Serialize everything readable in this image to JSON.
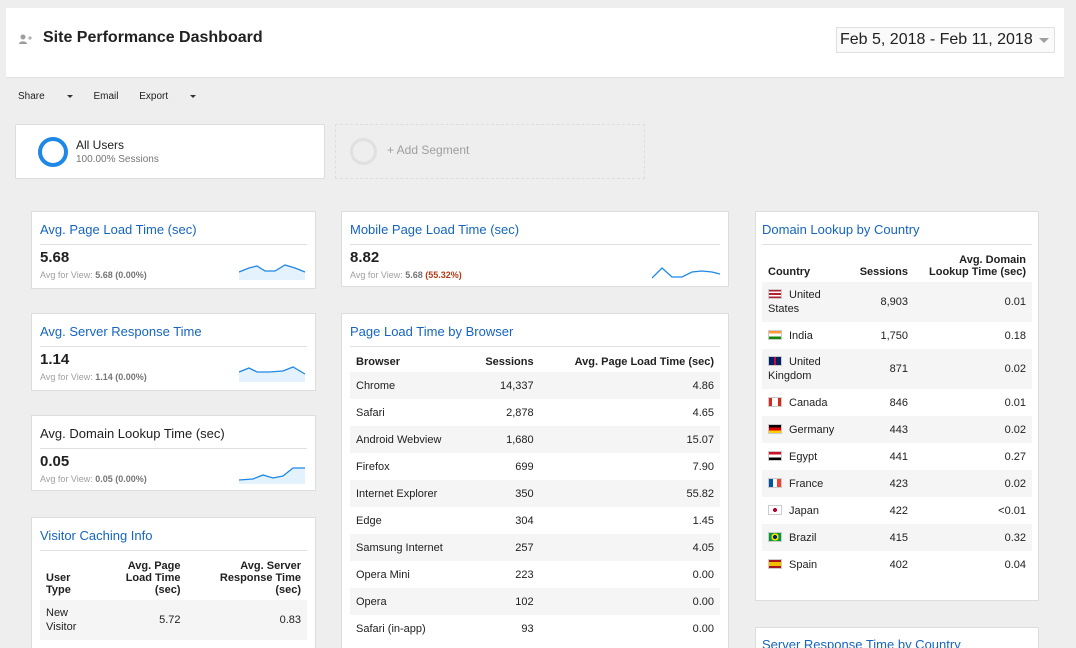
{
  "header": {
    "title": "Site Performance Dashboard",
    "date_range": "Feb 5, 2018 - Feb 11, 2018"
  },
  "toolbar": {
    "share": "Share",
    "email": "Email",
    "export": "Export"
  },
  "segments": {
    "all_users": {
      "name": "All Users",
      "sub": "100.00% Sessions"
    },
    "add_segment": "+ Add Segment"
  },
  "colors": {
    "accent": "#1e88e5",
    "link": "#1565c0",
    "warn": "#b23c17"
  },
  "avg_page_load": {
    "title": "Avg. Page Load Time (sec)",
    "value": "5.68",
    "avg_label": "Avg for View:",
    "avg_value": "5.68",
    "avg_change": "(0.00%)"
  },
  "avg_server": {
    "title": "Avg. Server Response Time",
    "value": "1.14",
    "avg_label": "Avg for View:",
    "avg_value": "1.14",
    "avg_change": "(0.00%)"
  },
  "avg_domain": {
    "title": "Avg. Domain Lookup Time (sec)",
    "value": "0.05",
    "avg_label": "Avg for View:",
    "avg_value": "0.05",
    "avg_change": "(0.00%)"
  },
  "mobile_load": {
    "title": "Mobile Page Load Time (sec)",
    "value": "8.82",
    "avg_label": "Avg for View:",
    "avg_value": "5.68",
    "avg_change": "(55.32%)"
  },
  "visitor_caching": {
    "title": "Visitor Caching Info",
    "headers": [
      "User Type",
      "Avg. Page Load Time (sec)",
      "Avg. Server Response Time (sec)"
    ],
    "rows": [
      {
        "type": "New Visitor",
        "load": "5.72",
        "server": "0.83"
      }
    ]
  },
  "browser_table": {
    "title": "Page Load Time by Browser",
    "headers": [
      "Browser",
      "Sessions",
      "Avg. Page Load Time (sec)"
    ],
    "rows": [
      {
        "browser": "Chrome",
        "sessions": "14,337",
        "load": "4.86"
      },
      {
        "browser": "Safari",
        "sessions": "2,878",
        "load": "4.65"
      },
      {
        "browser": "Android Webview",
        "sessions": "1,680",
        "load": "15.07"
      },
      {
        "browser": "Firefox",
        "sessions": "699",
        "load": "7.90"
      },
      {
        "browser": "Internet Explorer",
        "sessions": "350",
        "load": "55.82"
      },
      {
        "browser": "Edge",
        "sessions": "304",
        "load": "1.45"
      },
      {
        "browser": "Samsung Internet",
        "sessions": "257",
        "load": "4.05"
      },
      {
        "browser": "Opera Mini",
        "sessions": "223",
        "load": "0.00"
      },
      {
        "browser": "Opera",
        "sessions": "102",
        "load": "0.00"
      },
      {
        "browser": "Safari (in-app)",
        "sessions": "93",
        "load": "0.00"
      }
    ]
  },
  "domain_table": {
    "title": "Domain Lookup by Country",
    "headers": [
      "Country",
      "Sessions",
      "Avg. Domain Lookup Time (sec)"
    ],
    "rows": [
      {
        "country": "United States",
        "sessions": "8,903",
        "time": "0.01",
        "flag": "flag-us"
      },
      {
        "country": "India",
        "sessions": "1,750",
        "time": "0.18",
        "flag": "flag-in"
      },
      {
        "country": "United Kingdom",
        "sessions": "871",
        "time": "0.02",
        "flag": "flag-gb"
      },
      {
        "country": "Canada",
        "sessions": "846",
        "time": "0.01",
        "flag": "flag-ca"
      },
      {
        "country": "Germany",
        "sessions": "443",
        "time": "0.02",
        "flag": "flag-de"
      },
      {
        "country": "Egypt",
        "sessions": "441",
        "time": "0.27",
        "flag": "flag-eg"
      },
      {
        "country": "France",
        "sessions": "423",
        "time": "0.02",
        "flag": "flag-fr"
      },
      {
        "country": "Japan",
        "sessions": "422",
        "time": "<0.01",
        "flag": "flag-jp"
      },
      {
        "country": "Brazil",
        "sessions": "415",
        "time": "0.32",
        "flag": "flag-br"
      },
      {
        "country": "Spain",
        "sessions": "402",
        "time": "0.04",
        "flag": "flag-es"
      }
    ]
  },
  "server_by_country": {
    "title": "Server Response Time by Country"
  }
}
